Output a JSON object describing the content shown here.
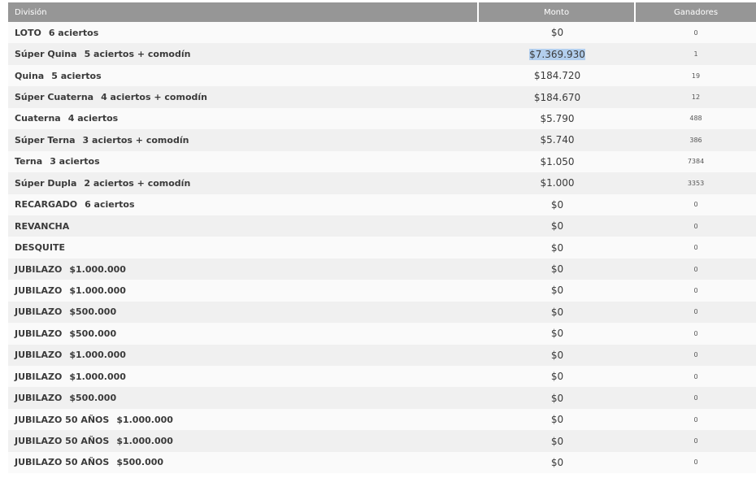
{
  "table": {
    "headers": {
      "division": "División",
      "monto": "Monto",
      "ganadores": "Ganadores"
    },
    "rows": [
      {
        "name": "LOTO",
        "detail": "6 aciertos",
        "monto": "$0",
        "ganadores": "0",
        "selected": false
      },
      {
        "name": "Súper Quina",
        "detail": "5 aciertos + comodín",
        "monto": "$7.369.930",
        "ganadores": "1",
        "selected": true
      },
      {
        "name": "Quina",
        "detail": "5 aciertos",
        "monto": "$184.720",
        "ganadores": "19",
        "selected": false
      },
      {
        "name": "Súper Cuaterna",
        "detail": "4 aciertos + comodín",
        "monto": "$184.670",
        "ganadores": "12",
        "selected": false
      },
      {
        "name": "Cuaterna",
        "detail": "4 aciertos",
        "monto": "$5.790",
        "ganadores": "488",
        "selected": false
      },
      {
        "name": "Súper Terna",
        "detail": "3 aciertos + comodín",
        "monto": "$5.740",
        "ganadores": "386",
        "selected": false
      },
      {
        "name": "Terna",
        "detail": "3 aciertos",
        "monto": "$1.050",
        "ganadores": "7384",
        "selected": false
      },
      {
        "name": "Súper Dupla",
        "detail": "2 aciertos + comodín",
        "monto": "$1.000",
        "ganadores": "3353",
        "selected": false
      },
      {
        "name": "RECARGADO",
        "detail": "6 aciertos",
        "monto": "$0",
        "ganadores": "0",
        "selected": false
      },
      {
        "name": "REVANCHA",
        "detail": "",
        "monto": "$0",
        "ganadores": "0",
        "selected": false
      },
      {
        "name": "DESQUITE",
        "detail": "",
        "monto": "$0",
        "ganadores": "0",
        "selected": false
      },
      {
        "name": "JUBILAZO",
        "detail": "$1.000.000",
        "monto": "$0",
        "ganadores": "0",
        "selected": false
      },
      {
        "name": "JUBILAZO",
        "detail": "$1.000.000",
        "monto": "$0",
        "ganadores": "0",
        "selected": false
      },
      {
        "name": "JUBILAZO",
        "detail": "$500.000",
        "monto": "$0",
        "ganadores": "0",
        "selected": false
      },
      {
        "name": "JUBILAZO",
        "detail": "$500.000",
        "monto": "$0",
        "ganadores": "0",
        "selected": false
      },
      {
        "name": "JUBILAZO",
        "detail": "$1.000.000",
        "monto": "$0",
        "ganadores": "0",
        "selected": false
      },
      {
        "name": "JUBILAZO",
        "detail": "$1.000.000",
        "monto": "$0",
        "ganadores": "0",
        "selected": false
      },
      {
        "name": "JUBILAZO",
        "detail": "$500.000",
        "monto": "$0",
        "ganadores": "0",
        "selected": false
      },
      {
        "name": "JUBILAZO 50 AÑOS",
        "detail": "$1.000.000",
        "monto": "$0",
        "ganadores": "0",
        "selected": false
      },
      {
        "name": "JUBILAZO 50 AÑOS",
        "detail": "$1.000.000",
        "monto": "$0",
        "ganadores": "0",
        "selected": false
      },
      {
        "name": "JUBILAZO 50 AÑOS",
        "detail": "$500.000",
        "monto": "$0",
        "ganadores": "0",
        "selected": false
      }
    ]
  },
  "colors": {
    "header_bg": "#969696",
    "row_even": "#f0f0f0",
    "row_odd": "#fafafa",
    "selection": "#b3cfee"
  }
}
